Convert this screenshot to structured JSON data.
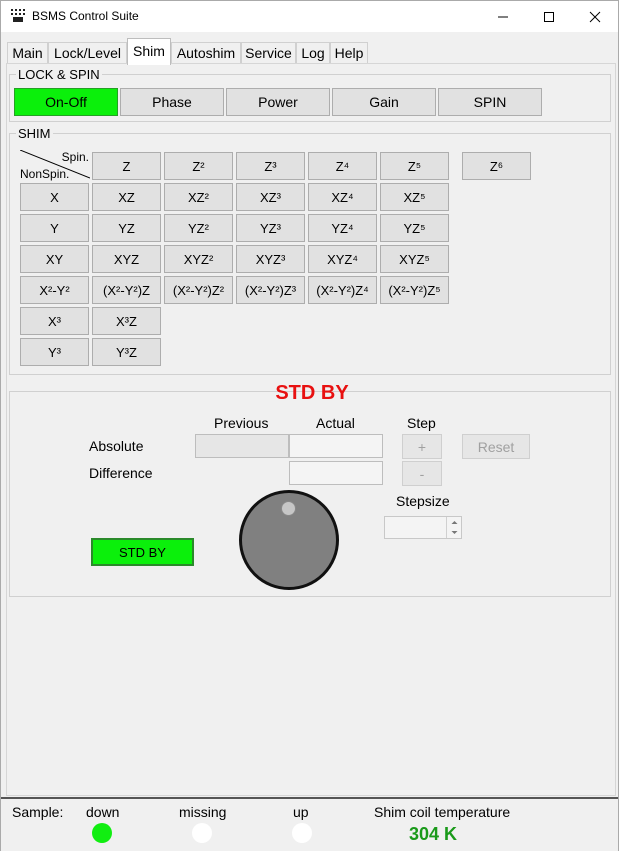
{
  "window": {
    "title": "BSMS Control Suite"
  },
  "tabs": [
    "Main",
    "Lock/Level",
    "Shim",
    "Autoshim",
    "Service",
    "Log",
    "Help"
  ],
  "lock_spin": {
    "title": "LOCK & SPIN",
    "buttons": [
      "On-Off",
      "Phase",
      "Power",
      "Gain",
      "SPIN"
    ]
  },
  "shim": {
    "title": "SHIM",
    "corner_spin": "Spin.",
    "corner_nonspin": "NonSpin.",
    "rows": [
      [
        "Z",
        "Z²",
        "Z³",
        "Z⁴",
        "Z⁵"
      ],
      [
        "X",
        "XZ",
        "XZ²",
        "XZ³",
        "XZ⁴",
        "XZ⁵"
      ],
      [
        "Y",
        "YZ",
        "YZ²",
        "YZ³",
        "YZ⁴",
        "YZ⁵"
      ],
      [
        "XY",
        "XYZ",
        "XYZ²",
        "XYZ³",
        "XYZ⁴",
        "XYZ⁵"
      ],
      [
        "X²-Y²",
        "(X²-Y²)Z",
        "(X²-Y²)Z²",
        "(X²-Y²)Z³",
        "(X²-Y²)Z⁴",
        "(X²-Y²)Z⁵"
      ],
      [
        "X³",
        "X³Z"
      ],
      [
        "Y³",
        "Y³Z"
      ]
    ],
    "extra": "Z⁶"
  },
  "control": {
    "status_title": "STD BY",
    "col_previous": "Previous",
    "col_actual": "Actual",
    "col_step": "Step",
    "row_absolute": "Absolute",
    "row_difference": "Difference",
    "plus": "+",
    "minus": "-",
    "reset": "Reset",
    "stepsize": "Stepsize",
    "stdby_button": "STD BY"
  },
  "status": {
    "sample_label": "Sample:",
    "down": "down",
    "missing": "missing",
    "up": "up",
    "temp_label": "Shim coil temperature",
    "temp_value": "304 K",
    "indicators": {
      "down": true,
      "missing": false,
      "up": false
    }
  },
  "colors": {
    "active_green": "#0bf00b",
    "alert_red": "#e81010",
    "temp_green": "#1a9a1a"
  }
}
